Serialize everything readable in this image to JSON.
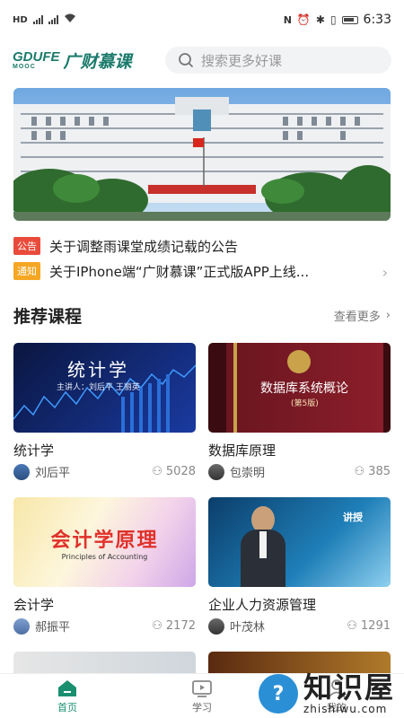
{
  "status_bar": {
    "left_icons": [
      "HD",
      "3G",
      "4G",
      "wifi-icon"
    ],
    "time": "6:33"
  },
  "header": {
    "logo_mark": "GDUFE",
    "logo_sub": "MOOC",
    "logo_text": "广财慕课",
    "search_placeholder": "搜索更多好课"
  },
  "notices": [
    {
      "tag": "公告",
      "text": "关于调整雨课堂成绩记载的公告"
    },
    {
      "tag": "通知",
      "text": "关于IPhone端“广财慕课”正式版APP上线..."
    }
  ],
  "recommend": {
    "title": "推荐课程",
    "more": "查看更多"
  },
  "courses": [
    {
      "name": "统计学",
      "teacher": "刘后平",
      "count": "5028",
      "thumb_title": "统计学",
      "thumb_sub": "主讲人：刘后平 王丽英"
    },
    {
      "name": "数据库原理",
      "teacher": "包崇明",
      "count": "385",
      "thumb_title": "数据库系统概论",
      "thumb_sub": "(第5版)"
    },
    {
      "name": "会计学",
      "teacher": "郝振平",
      "count": "2172",
      "thumb_title": "会计学原理",
      "thumb_sub": "Principles of Accounting"
    },
    {
      "name": "企业人力资源管理",
      "teacher": "叶茂林",
      "count": "1291",
      "thumb_title": "讲授",
      "thumb_sub": ""
    }
  ],
  "tabbar": {
    "home": "首页",
    "study": "学习",
    "mine": "我的"
  },
  "watermark": {
    "cn": "知识屋",
    "en": "zhishiwu.com"
  },
  "colors": {
    "accent": "#1a8f6f",
    "notice_red": "#e94b3b",
    "notice_orange": "#f5a623"
  }
}
